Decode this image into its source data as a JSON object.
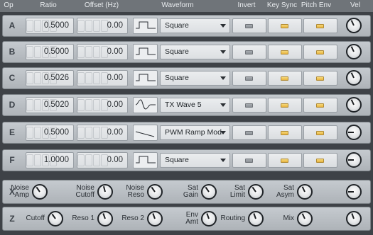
{
  "header": {
    "op": "Op",
    "ratio": "Ratio",
    "offset": "Offset (Hz)",
    "waveform": "Waveform",
    "invert": "Invert",
    "keysync": "Key Sync",
    "pitchenv": "Pitch Env",
    "vel": "Vel"
  },
  "operators": [
    {
      "op": "A",
      "ratio": "0.5000",
      "offset": "0.00",
      "waveform": "Square",
      "wave_icon": "square-wave-icon",
      "invert": "off",
      "keysync": "on",
      "pitchenv": "on",
      "vel_angle": -25
    },
    {
      "op": "B",
      "ratio": "0.5000",
      "offset": "0.00",
      "waveform": "Square",
      "wave_icon": "square-wave-icon",
      "invert": "off",
      "keysync": "on",
      "pitchenv": "on",
      "vel_angle": -25
    },
    {
      "op": "C",
      "ratio": "0.5026",
      "offset": "0.00",
      "waveform": "Square",
      "wave_icon": "square-wave-icon",
      "invert": "off",
      "keysync": "on",
      "pitchenv": "on",
      "vel_angle": -25
    },
    {
      "op": "D",
      "ratio": "0.5020",
      "offset": "0.00",
      "waveform": "TX Wave 5",
      "wave_icon": "tx-wave-icon",
      "invert": "off",
      "keysync": "on",
      "pitchenv": "on",
      "vel_angle": -25
    },
    {
      "op": "E",
      "ratio": "0.5000",
      "offset": "0.00",
      "waveform": "PWM Ramp Mod",
      "wave_icon": "ramp-wave-icon",
      "invert": "off",
      "keysync": "on",
      "pitchenv": "on",
      "vel_angle": -90
    },
    {
      "op": "F",
      "ratio": "1.0000",
      "offset": "0.00",
      "waveform": "Square",
      "wave_icon": "square-wave-icon",
      "invert": "off",
      "keysync": "on",
      "pitchenv": "on",
      "vel_angle": -90
    }
  ],
  "row_x": {
    "label": "X",
    "knobs": [
      {
        "label": "Noise\nAmp",
        "angle": -35
      },
      {
        "label": "Noise\nCutoff",
        "angle": -15
      },
      {
        "label": "Noise\nReso",
        "angle": -35
      },
      {
        "label": "Sat\nGain",
        "angle": -35
      },
      {
        "label": "Sat\nLimit",
        "angle": -35
      },
      {
        "label": "Sat\nAsym",
        "angle": -25
      },
      {
        "label": "",
        "angle": -90
      }
    ]
  },
  "row_z": {
    "label": "Z",
    "knobs": [
      {
        "label": "Cutoff",
        "angle": -35
      },
      {
        "label": "Reso 1",
        "angle": -20
      },
      {
        "label": "Reso 2",
        "angle": -20
      },
      {
        "label": "Env\nAmt",
        "angle": -20
      },
      {
        "label": "Routing",
        "angle": -20
      },
      {
        "label": "Mix",
        "angle": -25
      },
      {
        "label": "",
        "angle": -20
      }
    ]
  },
  "colors": {
    "background": "#3e4247",
    "header": "#6f7479",
    "led_on": "#f0c65a",
    "led_off": "#9ca1a6"
  }
}
